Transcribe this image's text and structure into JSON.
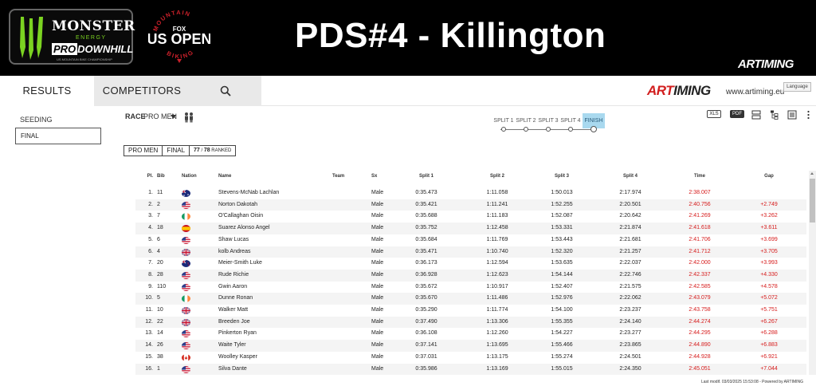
{
  "banner": {
    "title": "PDS#4 - Killington",
    "sponsor": {
      "brand": "MONSTER",
      "energy": "ENERGY",
      "pro": "PRO",
      "downhill": "DOWNHILL",
      "tagline": "US MOUNTAIN BIKE CHAMPIONSHIP"
    },
    "event_logo": {
      "arc_top": "MOUNTAIN",
      "fox": "FOX",
      "us_open": "US OPEN",
      "arc_bottom": "BIKING"
    },
    "timer_logo": "ARTIMING"
  },
  "nav": {
    "tab_results": "RESULTS",
    "tab_competitors": "COMPETITORS",
    "brand_art": "ART",
    "brand_timing": "IMING",
    "url": "www.artiming.eu",
    "language": "Language"
  },
  "sidebar": {
    "seeding": "SEEDING",
    "final": "FINAL"
  },
  "filters": {
    "race_label": "RACE",
    "race_value": "PRO MEN",
    "splits": [
      "SPLIT 1",
      "SPLIT 2",
      "SPLIT 3",
      "SPLIT 4",
      "FINISH"
    ],
    "active_split": "FINISH",
    "tools": {
      "xls": "XLS",
      "pdf": "PDF"
    }
  },
  "badges": {
    "category": "PRO MEN",
    "stage": "FINAL",
    "ranked_count": "77",
    "ranked_sep": "/",
    "ranked_total": "78",
    "ranked_label": "RANKED"
  },
  "table": {
    "headers": {
      "pl": "Pl.",
      "bib": "Bib",
      "nation": "Nation",
      "name": "Name",
      "team": "Team",
      "sx": "Sx",
      "split1": "Split 1",
      "split2": "Split 2",
      "split3": "Split 3",
      "split4": "Split 4",
      "time": "Time",
      "gap": "Gap"
    },
    "rows": [
      {
        "pl": "1.",
        "bib": "11",
        "nation": "AUS",
        "name": "Stevens-McNab Lachlan",
        "team": "",
        "sx": "Male",
        "s1": "0:35.473",
        "s2": "1:11.058",
        "s3": "1:50.013",
        "s4": "2:17.974",
        "time": "2:38.007",
        "gap": ""
      },
      {
        "pl": "2.",
        "bib": "2",
        "nation": "USA",
        "name": "Norton Dakotah",
        "team": "",
        "sx": "Male",
        "s1": "0:35.421",
        "s2": "1:11.241",
        "s3": "1:52.255",
        "s4": "2:20.501",
        "time": "2:40.756",
        "gap": "+2.749"
      },
      {
        "pl": "3.",
        "bib": "7",
        "nation": "IRL",
        "name": "O'Callaghan Oisin",
        "team": "",
        "sx": "Male",
        "s1": "0:35.688",
        "s2": "1:11.183",
        "s3": "1:52.087",
        "s4": "2:20.642",
        "time": "2:41.269",
        "gap": "+3.262"
      },
      {
        "pl": "4.",
        "bib": "18",
        "nation": "ESP",
        "name": "Suarez Alonso Angel",
        "team": "",
        "sx": "Male",
        "s1": "0:35.752",
        "s2": "1:12.458",
        "s3": "1:53.331",
        "s4": "2:21.874",
        "time": "2:41.618",
        "gap": "+3.611"
      },
      {
        "pl": "5.",
        "bib": "6",
        "nation": "USA",
        "name": "Shaw Lucas",
        "team": "",
        "sx": "Male",
        "s1": "0:35.684",
        "s2": "1:11.769",
        "s3": "1:53.443",
        "s4": "2:21.681",
        "time": "2:41.706",
        "gap": "+3.699"
      },
      {
        "pl": "6.",
        "bib": "4",
        "nation": "GBR",
        "name": "kolb Andreas",
        "team": "",
        "sx": "Male",
        "s1": "0:35.471",
        "s2": "1:10.740",
        "s3": "1:52.320",
        "s4": "2:21.257",
        "time": "2:41.712",
        "gap": "+3.705"
      },
      {
        "pl": "7.",
        "bib": "20",
        "nation": "NZL",
        "name": "Meier-Smith Luke",
        "team": "",
        "sx": "Male",
        "s1": "0:36.173",
        "s2": "1:12.594",
        "s3": "1:53.635",
        "s4": "2:22.037",
        "time": "2:42.000",
        "gap": "+3.993"
      },
      {
        "pl": "8.",
        "bib": "28",
        "nation": "USA",
        "name": "Rude Richie",
        "team": "",
        "sx": "Male",
        "s1": "0:36.928",
        "s2": "1:12.623",
        "s3": "1:54.144",
        "s4": "2:22.746",
        "time": "2:42.337",
        "gap": "+4.330"
      },
      {
        "pl": "9.",
        "bib": "110",
        "nation": "USA",
        "name": "Gwin Aaron",
        "team": "",
        "sx": "Male",
        "s1": "0:35.672",
        "s2": "1:10.917",
        "s3": "1:52.407",
        "s4": "2:21.575",
        "time": "2:42.585",
        "gap": "+4.578"
      },
      {
        "pl": "10.",
        "bib": "5",
        "nation": "IRL",
        "name": "Dunne Ronan",
        "team": "",
        "sx": "Male",
        "s1": "0:35.670",
        "s2": "1:11.486",
        "s3": "1:52.976",
        "s4": "2:22.062",
        "time": "2:43.079",
        "gap": "+5.072"
      },
      {
        "pl": "11.",
        "bib": "10",
        "nation": "GBR",
        "name": "Walker Matt",
        "team": "",
        "sx": "Male",
        "s1": "0:35.290",
        "s2": "1:11.774",
        "s3": "1:54.100",
        "s4": "2:23.237",
        "time": "2:43.758",
        "gap": "+5.751"
      },
      {
        "pl": "12.",
        "bib": "22",
        "nation": "GBR",
        "name": "Breeden Joe",
        "team": "",
        "sx": "Male",
        "s1": "0:37.490",
        "s2": "1:13.306",
        "s3": "1:55.355",
        "s4": "2:24.140",
        "time": "2:44.274",
        "gap": "+6.267"
      },
      {
        "pl": "13.",
        "bib": "14",
        "nation": "USA",
        "name": "Pinkerton Ryan",
        "team": "",
        "sx": "Male",
        "s1": "0:36.108",
        "s2": "1:12.260",
        "s3": "1:54.227",
        "s4": "2:23.277",
        "time": "2:44.295",
        "gap": "+6.288"
      },
      {
        "pl": "14.",
        "bib": "26",
        "nation": "USA",
        "name": "Waite Tyler",
        "team": "",
        "sx": "Male",
        "s1": "0:37.141",
        "s2": "1:13.695",
        "s3": "1:55.466",
        "s4": "2:23.865",
        "time": "2:44.890",
        "gap": "+6.883"
      },
      {
        "pl": "15.",
        "bib": "38",
        "nation": "CAN",
        "name": "Woolley Kasper",
        "team": "",
        "sx": "Male",
        "s1": "0:37.031",
        "s2": "1:13.175",
        "s3": "1:55.274",
        "s4": "2:24.501",
        "time": "2:44.928",
        "gap": "+6.921"
      },
      {
        "pl": "16.",
        "bib": "1",
        "nation": "USA",
        "name": "Silva Dante",
        "team": "",
        "sx": "Male",
        "s1": "0:35.986",
        "s2": "1:13.169",
        "s3": "1:55.015",
        "s4": "2:24.350",
        "time": "2:45.051",
        "gap": "+7.044"
      }
    ]
  },
  "footer": "Last modif. 03/03/2025 15:53:08 - Powered by ARTIMING",
  "colors": {
    "banner": "#000000",
    "accent_red": "#d61a1a",
    "monster_green": "#7bd321",
    "active_split": "#a9d9ef"
  }
}
